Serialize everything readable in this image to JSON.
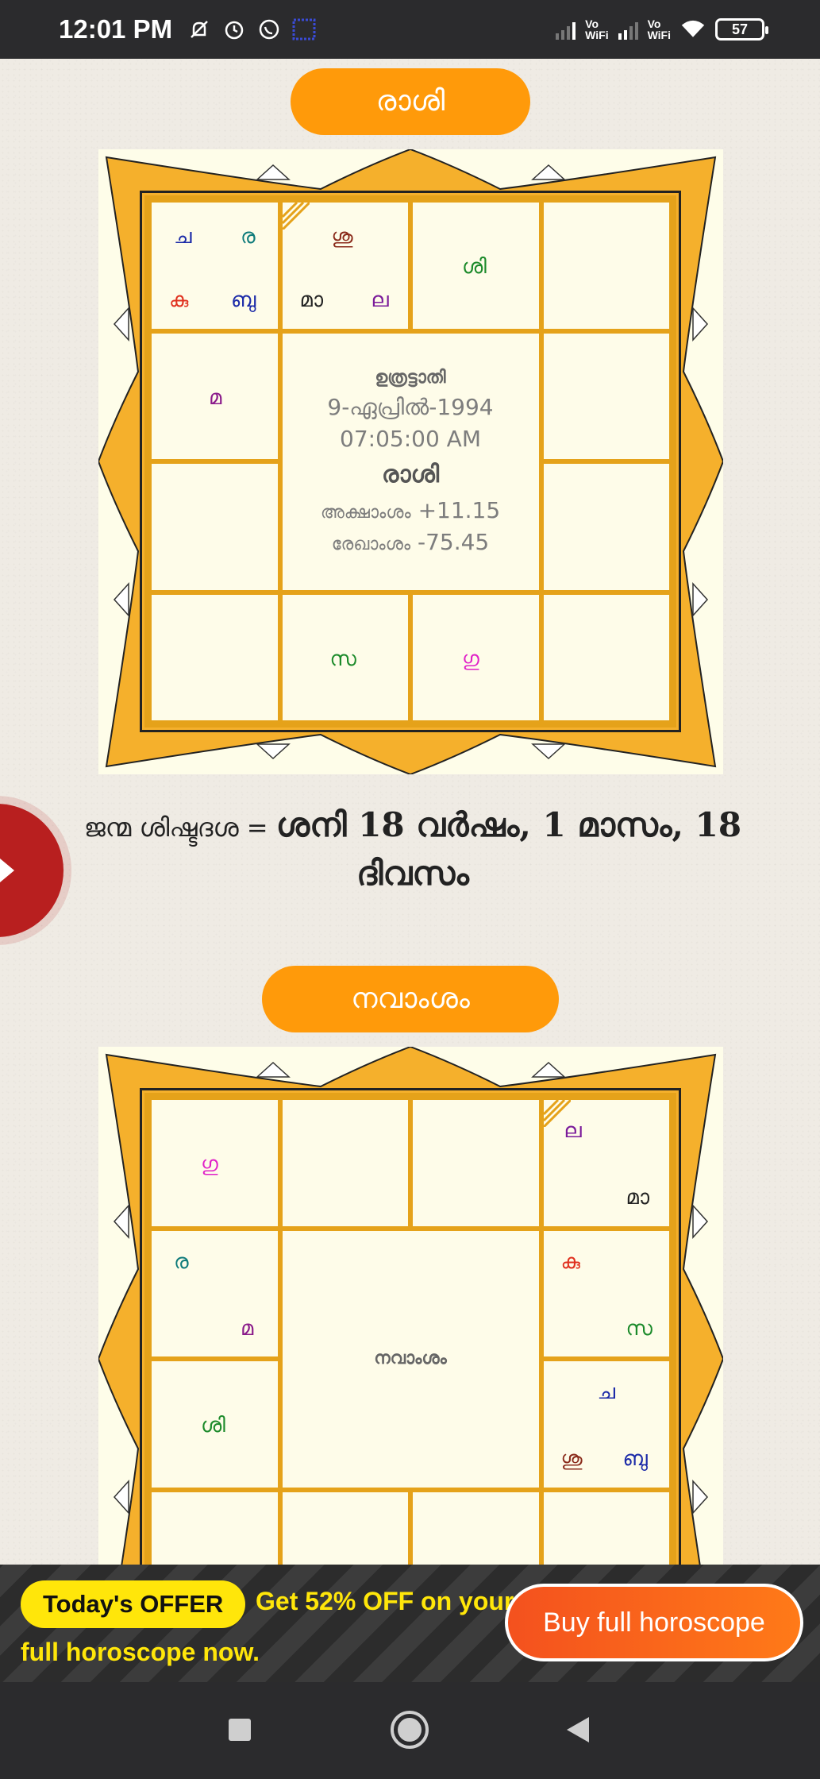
{
  "status_bar": {
    "time": "12:01 PM",
    "left_icons": [
      "mute-bell-icon",
      "alarm-icon",
      "whatsapp-icon",
      "gallery-icon"
    ],
    "vowifi_1": "Vo\nWiFi",
    "vowifi_2": "Vo\nWiFi",
    "battery": "57"
  },
  "rashi": {
    "title": "രാശി",
    "cells": {
      "c1": [
        "ച",
        "ര",
        "കു",
        "ബു"
      ],
      "c2": [
        "ശു",
        "മാ",
        "ല"
      ],
      "c3": [
        "ശി"
      ],
      "c5": [
        "മ"
      ],
      "c14": [
        "സ"
      ],
      "c15": [
        "ഗു"
      ]
    },
    "center": {
      "nakshatra": "ഉത്രട്ടാതി",
      "date": "9-ഏപ്രിൽ-1994",
      "time": "07:05:00 AM",
      "chart_name": "രാശി",
      "latitude_label": "അക്ഷാംശം",
      "latitude_value": "+11.15",
      "longitude_label": "രേഖാംശം",
      "longitude_value": "-75.45"
    }
  },
  "dasha": {
    "label": "ജന്മ ശിഷ്ടദശ = ",
    "value": "ശനി 18 വര്‍ഷം, 1 മാസം, 18 ദിവസം"
  },
  "navamsha": {
    "title": "നവാംശം",
    "center_label": "നവാംശം",
    "cells": {
      "c1": [
        "ഗു"
      ],
      "c4": [
        "ല",
        "മാ"
      ],
      "c5": [
        "ര",
        "മ"
      ],
      "c8": [
        "കു",
        "സ"
      ],
      "c9": [
        "ശി"
      ],
      "c12": [
        "ച",
        "ശു",
        "ബു"
      ]
    }
  },
  "offer": {
    "badge": "Today's OFFER",
    "line1": "Get 52% OFF on your",
    "line2": "full horoscope now.",
    "button": "Buy full horoscope"
  },
  "colors": {
    "accent_orange": "#ff9a0a",
    "chart_gold": "#e5a21a",
    "offer_yellow": "#ffe60a",
    "buy_button": "#f4511e",
    "side_tab": "#b81f1f"
  },
  "icons": {
    "side_tab": "play-arrow-icon",
    "nav": [
      "recents-square-icon",
      "home-circle-icon",
      "back-triangle-icon"
    ]
  }
}
